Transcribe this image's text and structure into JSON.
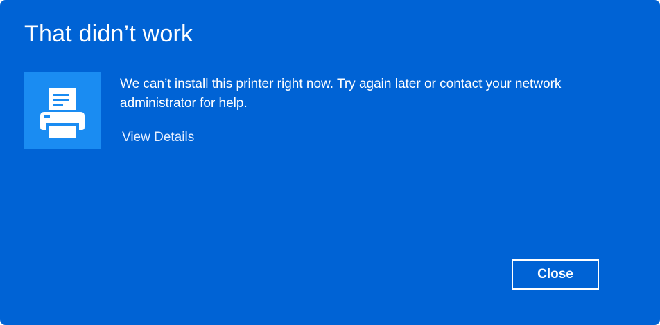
{
  "dialog": {
    "title": "That didn’t work",
    "message": "We can’t install this printer right now. Try again later or contact your network administrator for help.",
    "details_link": "View Details",
    "close_label": "Close",
    "icon": "printer-icon"
  },
  "colors": {
    "background": "#0063d5",
    "icon_tile": "#1a8cf2",
    "text": "#ffffff"
  }
}
